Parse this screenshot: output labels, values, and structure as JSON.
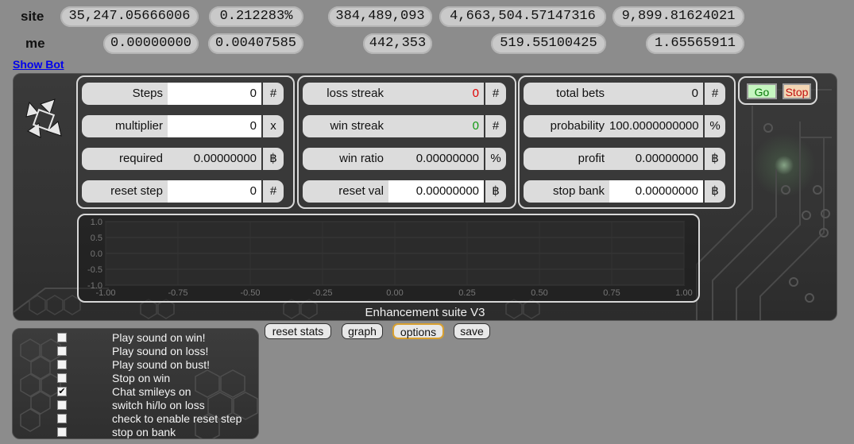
{
  "stats": {
    "site": {
      "label": "site",
      "values": [
        "35,247.05666006",
        "0.212283%",
        "384,489,093",
        "4,663,504.57147316",
        "9,899.81624021"
      ]
    },
    "me": {
      "label": "me",
      "values": [
        "0.00000000",
        "0.00407585",
        "442,353",
        "519.55100425",
        "1.65565911"
      ]
    }
  },
  "show_bot_link": "Show Bot",
  "controls": {
    "col1": [
      {
        "label": "Steps",
        "value": "0",
        "unit": "#"
      },
      {
        "label": "multiplier",
        "value": "0",
        "unit": "x"
      },
      {
        "label": "required",
        "value": "0.00000000",
        "unit": "฿"
      },
      {
        "label": "reset step",
        "value": "0",
        "unit": "#"
      }
    ],
    "col2": [
      {
        "label": "loss streak",
        "value": "0",
        "unit": "#"
      },
      {
        "label": "win streak",
        "value": "0",
        "unit": "#"
      },
      {
        "label": "win ratio",
        "value": "0.00000000",
        "unit": "%"
      },
      {
        "label": "reset val",
        "value": "0.00000000",
        "unit": "฿"
      }
    ],
    "col3": [
      {
        "label": "total bets",
        "value": "0",
        "unit": "#"
      },
      {
        "label": "probability",
        "value": "100.0000000000",
        "unit": "%"
      },
      {
        "label": "profit",
        "value": "0.00000000",
        "unit": "฿"
      },
      {
        "label": "stop bank",
        "value": "0.00000000",
        "unit": "฿"
      }
    ],
    "go_label": "Go",
    "stop_label": "Stop"
  },
  "chart_data": {
    "type": "line",
    "series": [],
    "xlim": [
      -1.0,
      1.0
    ],
    "ylim": [
      -1.0,
      1.0
    ],
    "x_ticks": [
      "-1.00",
      "-0.75",
      "-0.50",
      "-0.25",
      "0.00",
      "0.25",
      "0.50",
      "0.75",
      "1.00"
    ],
    "y_ticks": [
      "1.0",
      "0.5",
      "0.0",
      "-0.5",
      "-1.0"
    ],
    "grid": true
  },
  "suite_title": "Enhancement suite V3",
  "toolbar": {
    "reset_stats": "reset stats",
    "graph": "graph",
    "options": "options",
    "save": "save"
  },
  "options": [
    {
      "label": "Play sound on win!",
      "checked": false
    },
    {
      "label": "Play sound on loss!",
      "checked": false
    },
    {
      "label": "Play sound on bust!",
      "checked": false
    },
    {
      "label": "Stop on win",
      "checked": false
    },
    {
      "label": "Chat smileys on",
      "checked": true
    },
    {
      "label": "switch hi/lo on loss",
      "checked": false
    },
    {
      "label": "check to enable reset step",
      "checked": false
    },
    {
      "label": "stop on bank",
      "checked": false
    }
  ],
  "colors": {
    "loss_streak": "#e00000",
    "win_streak": "#119911"
  }
}
